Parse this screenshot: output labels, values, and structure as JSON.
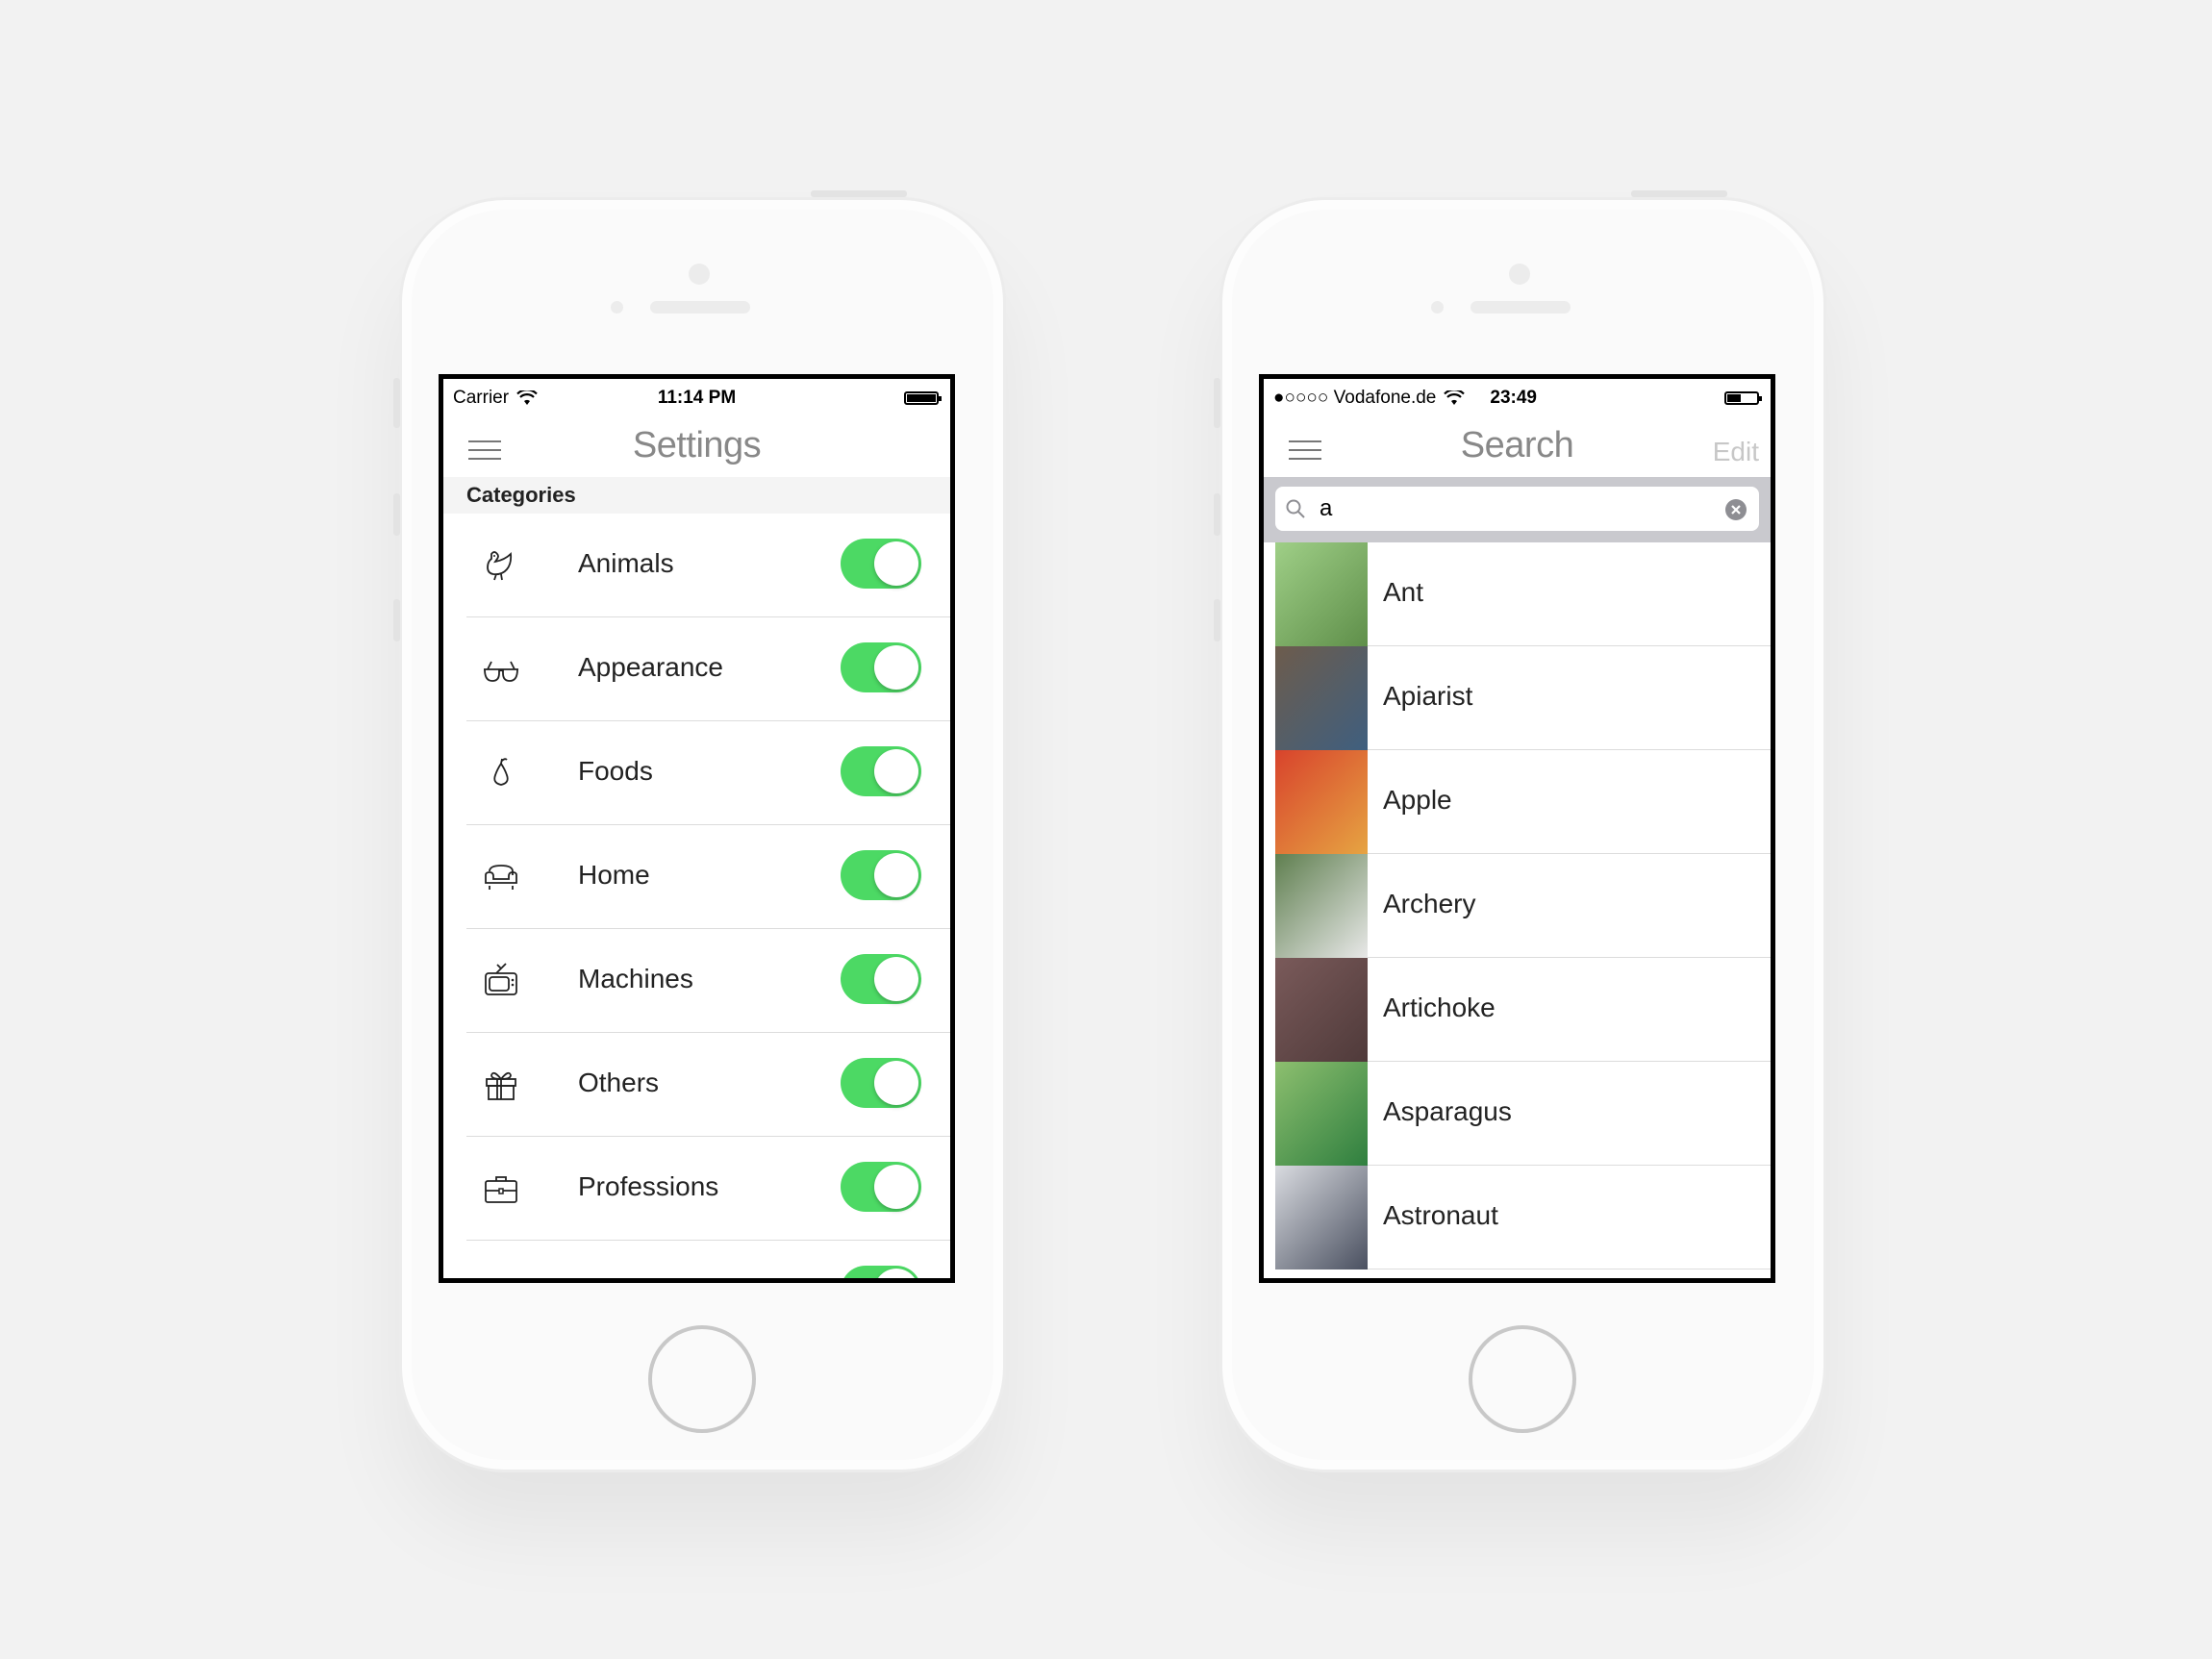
{
  "settings_screen": {
    "status": {
      "carrier": "Carrier",
      "time": "11:14 PM",
      "battery_level": 1.0
    },
    "nav": {
      "title": "Settings"
    },
    "section_header": "Categories",
    "rows": [
      {
        "label": "Animals",
        "icon": "chicken-icon",
        "enabled": true
      },
      {
        "label": "Appearance",
        "icon": "glasses-icon",
        "enabled": true
      },
      {
        "label": "Foods",
        "icon": "pear-icon",
        "enabled": true
      },
      {
        "label": "Home",
        "icon": "armchair-icon",
        "enabled": true
      },
      {
        "label": "Machines",
        "icon": "tv-icon",
        "enabled": true
      },
      {
        "label": "Others",
        "icon": "gift-icon",
        "enabled": true
      },
      {
        "label": "Professions",
        "icon": "briefcase-icon",
        "enabled": true
      }
    ],
    "toggle_color": "#4cd964"
  },
  "search_screen": {
    "status": {
      "carrier": "●○○○○ Vodafone.de",
      "time": "23:49",
      "battery_level": 0.45
    },
    "nav": {
      "title": "Search",
      "edit_label": "Edit"
    },
    "search": {
      "value": "a"
    },
    "results": [
      {
        "label": "Ant",
        "thumb_colors": [
          "#9fcf87",
          "#5f8f4a"
        ]
      },
      {
        "label": "Apiarist",
        "thumb_colors": [
          "#6d5c4c",
          "#3f5f7f"
        ]
      },
      {
        "label": "Apple",
        "thumb_colors": [
          "#d8432c",
          "#e6a442"
        ]
      },
      {
        "label": "Archery",
        "thumb_colors": [
          "#5f7f4f",
          "#e8e8e8"
        ]
      },
      {
        "label": "Artichoke",
        "thumb_colors": [
          "#7a5a5a",
          "#4f3a3a"
        ]
      },
      {
        "label": "Asparagus",
        "thumb_colors": [
          "#8dbf6f",
          "#2f7f3f"
        ]
      },
      {
        "label": "Astronaut",
        "thumb_colors": [
          "#d9dbe0",
          "#4a5060"
        ]
      }
    ]
  }
}
